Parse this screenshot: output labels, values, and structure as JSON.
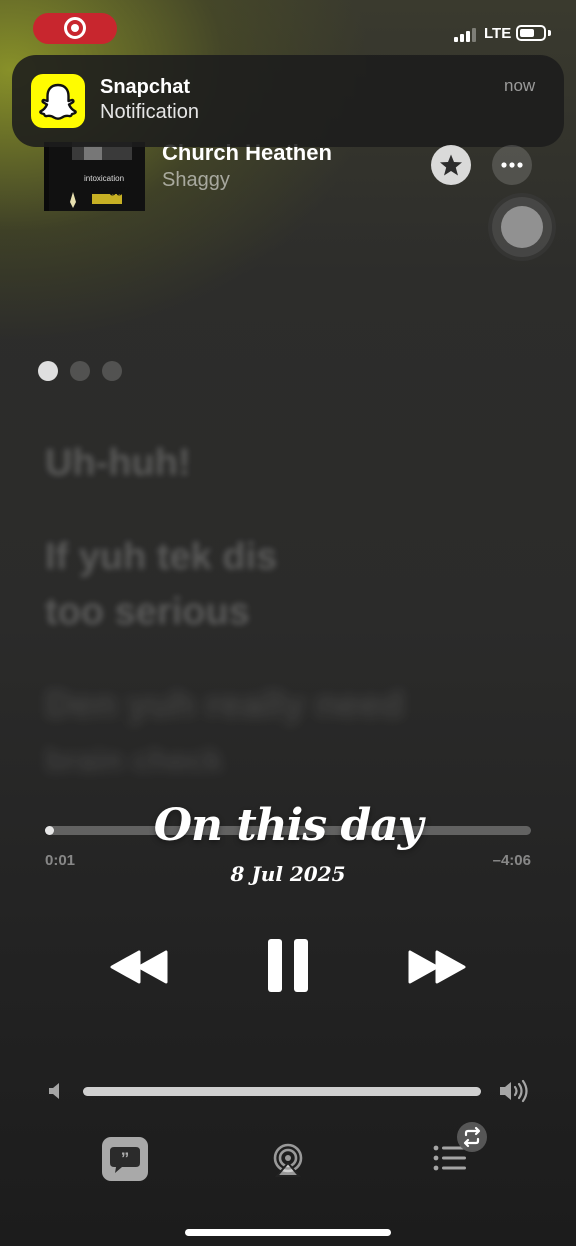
{
  "status_bar": {
    "network": "LTE",
    "battery_fraction": 0.55
  },
  "notification": {
    "app": "Snapchat",
    "body": "Notification",
    "time": "now",
    "icon": "snapchat-ghost-icon"
  },
  "now_playing": {
    "title": "Church Heathen",
    "artist": "Shaggy",
    "artwork_text": "Shaggy",
    "artwork_top_text": "intoxication"
  },
  "page_dots": {
    "count": 3,
    "active": 0
  },
  "lyrics": {
    "line1": "Uh-huh!",
    "line2a": "If yuh tek dis",
    "line2b": "too serious",
    "line3a": "Den yuh really need",
    "line3b": "brain check"
  },
  "playback": {
    "elapsed": "0:01",
    "remaining": "–4:06",
    "progress_fraction": 0.004
  },
  "memory_overlay": {
    "title": "On this day",
    "date": "8 Jul 2025"
  },
  "volume": {
    "level_fraction": 1.0
  },
  "icons": {
    "favorite": "star-icon",
    "more": "ellipsis-icon",
    "previous": "backward-icon",
    "pause": "pause-icon",
    "next": "forward-icon",
    "lyrics": "lyrics-quote-icon",
    "airplay": "airplay-icon",
    "queue": "list-icon",
    "repeat": "repeat-icon"
  }
}
